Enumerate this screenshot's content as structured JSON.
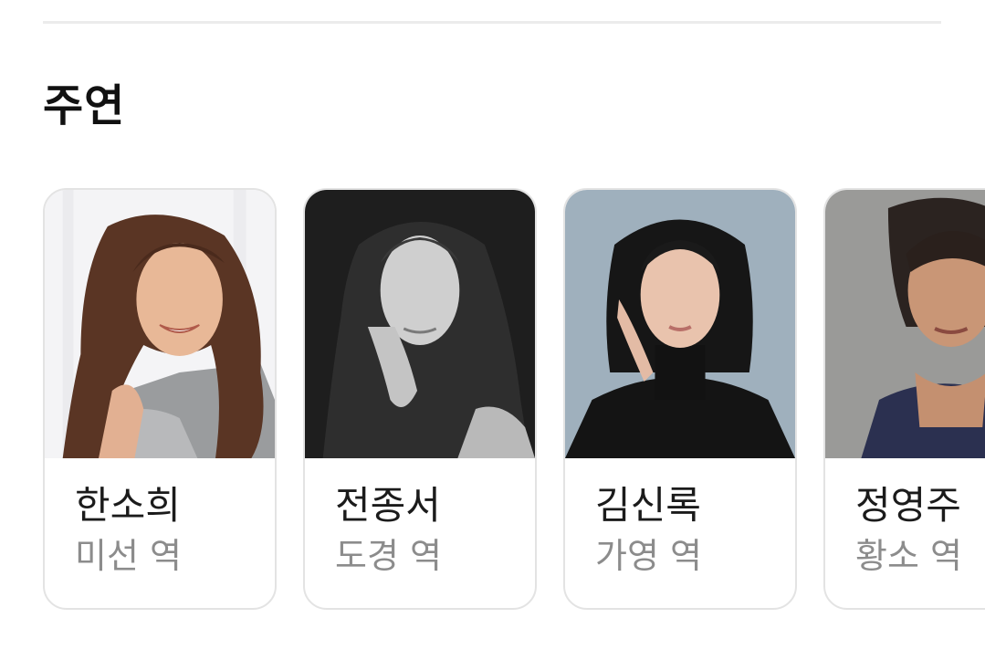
{
  "section": {
    "title": "주연"
  },
  "cast": [
    {
      "name": "한소희",
      "role": "미선 역",
      "photo_icon": "actor-portrait"
    },
    {
      "name": "전종서",
      "role": "도경 역",
      "photo_icon": "actor-portrait"
    },
    {
      "name": "김신록",
      "role": "가영 역",
      "photo_icon": "actor-portrait"
    },
    {
      "name": "정영주",
      "role": "황소 역",
      "photo_icon": "actor-portrait"
    }
  ],
  "colors": {
    "card_border": "#e3e3e3",
    "name_text": "#1b1b1b",
    "role_text": "#8c8c8c",
    "divider": "#ececec"
  }
}
